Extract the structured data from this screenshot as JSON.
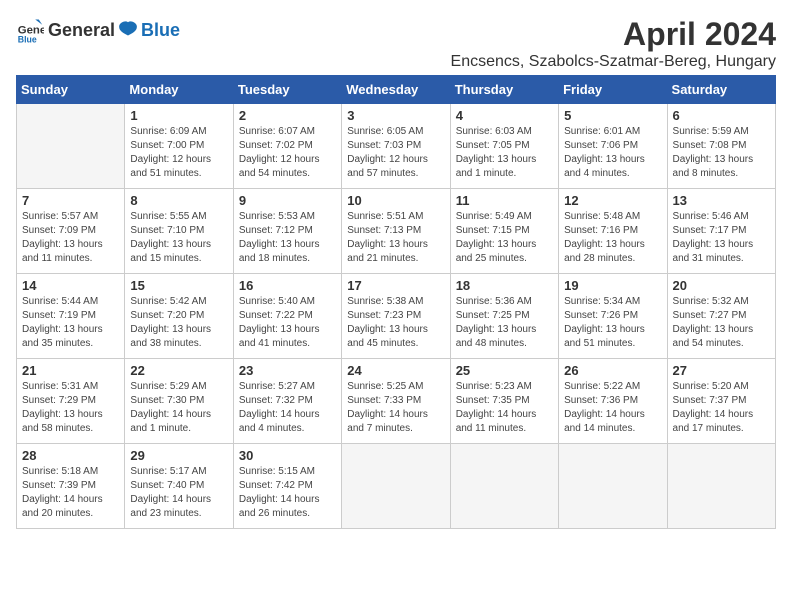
{
  "header": {
    "logo_general": "General",
    "logo_blue": "Blue",
    "month_year": "April 2024",
    "location": "Encsencs, Szabolcs-Szatmar-Bereg, Hungary"
  },
  "days_of_week": [
    "Sunday",
    "Monday",
    "Tuesday",
    "Wednesday",
    "Thursday",
    "Friday",
    "Saturday"
  ],
  "weeks": [
    [
      {
        "day": null,
        "info": null
      },
      {
        "day": "1",
        "info": "Sunrise: 6:09 AM\nSunset: 7:00 PM\nDaylight: 12 hours\nand 51 minutes."
      },
      {
        "day": "2",
        "info": "Sunrise: 6:07 AM\nSunset: 7:02 PM\nDaylight: 12 hours\nand 54 minutes."
      },
      {
        "day": "3",
        "info": "Sunrise: 6:05 AM\nSunset: 7:03 PM\nDaylight: 12 hours\nand 57 minutes."
      },
      {
        "day": "4",
        "info": "Sunrise: 6:03 AM\nSunset: 7:05 PM\nDaylight: 13 hours\nand 1 minute."
      },
      {
        "day": "5",
        "info": "Sunrise: 6:01 AM\nSunset: 7:06 PM\nDaylight: 13 hours\nand 4 minutes."
      },
      {
        "day": "6",
        "info": "Sunrise: 5:59 AM\nSunset: 7:08 PM\nDaylight: 13 hours\nand 8 minutes."
      }
    ],
    [
      {
        "day": "7",
        "info": "Sunrise: 5:57 AM\nSunset: 7:09 PM\nDaylight: 13 hours\nand 11 minutes."
      },
      {
        "day": "8",
        "info": "Sunrise: 5:55 AM\nSunset: 7:10 PM\nDaylight: 13 hours\nand 15 minutes."
      },
      {
        "day": "9",
        "info": "Sunrise: 5:53 AM\nSunset: 7:12 PM\nDaylight: 13 hours\nand 18 minutes."
      },
      {
        "day": "10",
        "info": "Sunrise: 5:51 AM\nSunset: 7:13 PM\nDaylight: 13 hours\nand 21 minutes."
      },
      {
        "day": "11",
        "info": "Sunrise: 5:49 AM\nSunset: 7:15 PM\nDaylight: 13 hours\nand 25 minutes."
      },
      {
        "day": "12",
        "info": "Sunrise: 5:48 AM\nSunset: 7:16 PM\nDaylight: 13 hours\nand 28 minutes."
      },
      {
        "day": "13",
        "info": "Sunrise: 5:46 AM\nSunset: 7:17 PM\nDaylight: 13 hours\nand 31 minutes."
      }
    ],
    [
      {
        "day": "14",
        "info": "Sunrise: 5:44 AM\nSunset: 7:19 PM\nDaylight: 13 hours\nand 35 minutes."
      },
      {
        "day": "15",
        "info": "Sunrise: 5:42 AM\nSunset: 7:20 PM\nDaylight: 13 hours\nand 38 minutes."
      },
      {
        "day": "16",
        "info": "Sunrise: 5:40 AM\nSunset: 7:22 PM\nDaylight: 13 hours\nand 41 minutes."
      },
      {
        "day": "17",
        "info": "Sunrise: 5:38 AM\nSunset: 7:23 PM\nDaylight: 13 hours\nand 45 minutes."
      },
      {
        "day": "18",
        "info": "Sunrise: 5:36 AM\nSunset: 7:25 PM\nDaylight: 13 hours\nand 48 minutes."
      },
      {
        "day": "19",
        "info": "Sunrise: 5:34 AM\nSunset: 7:26 PM\nDaylight: 13 hours\nand 51 minutes."
      },
      {
        "day": "20",
        "info": "Sunrise: 5:32 AM\nSunset: 7:27 PM\nDaylight: 13 hours\nand 54 minutes."
      }
    ],
    [
      {
        "day": "21",
        "info": "Sunrise: 5:31 AM\nSunset: 7:29 PM\nDaylight: 13 hours\nand 58 minutes."
      },
      {
        "day": "22",
        "info": "Sunrise: 5:29 AM\nSunset: 7:30 PM\nDaylight: 14 hours\nand 1 minute."
      },
      {
        "day": "23",
        "info": "Sunrise: 5:27 AM\nSunset: 7:32 PM\nDaylight: 14 hours\nand 4 minutes."
      },
      {
        "day": "24",
        "info": "Sunrise: 5:25 AM\nSunset: 7:33 PM\nDaylight: 14 hours\nand 7 minutes."
      },
      {
        "day": "25",
        "info": "Sunrise: 5:23 AM\nSunset: 7:35 PM\nDaylight: 14 hours\nand 11 minutes."
      },
      {
        "day": "26",
        "info": "Sunrise: 5:22 AM\nSunset: 7:36 PM\nDaylight: 14 hours\nand 14 minutes."
      },
      {
        "day": "27",
        "info": "Sunrise: 5:20 AM\nSunset: 7:37 PM\nDaylight: 14 hours\nand 17 minutes."
      }
    ],
    [
      {
        "day": "28",
        "info": "Sunrise: 5:18 AM\nSunset: 7:39 PM\nDaylight: 14 hours\nand 20 minutes."
      },
      {
        "day": "29",
        "info": "Sunrise: 5:17 AM\nSunset: 7:40 PM\nDaylight: 14 hours\nand 23 minutes."
      },
      {
        "day": "30",
        "info": "Sunrise: 5:15 AM\nSunset: 7:42 PM\nDaylight: 14 hours\nand 26 minutes."
      },
      {
        "day": null,
        "info": null
      },
      {
        "day": null,
        "info": null
      },
      {
        "day": null,
        "info": null
      },
      {
        "day": null,
        "info": null
      }
    ]
  ]
}
